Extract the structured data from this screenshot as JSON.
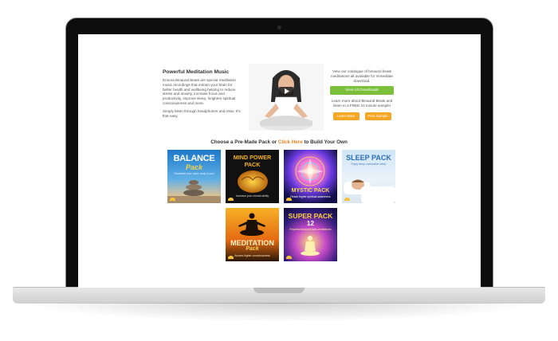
{
  "intro": {
    "title": "Powerful Meditation Music",
    "paragraph1": "Ennora Binaural Beats are special meditation music recordings that entrain your brain for better health and wellbeing helping to reduce stress and anxiety, increase focus and productivity, improve sleep, heighten spiritual consciousness and more.",
    "paragraph2": "Simply listen through headphones and relax. It's that easy.",
    "catalogue_text": "View our catalogue of binaural beats meditations all available for immediate download.",
    "view_downloads_label": "View All Downloads",
    "learn_more_text": "Learn more about Binaural Beats and listen to a FREE 10 minute sample!",
    "learn_more_label": "Learn More",
    "free_sample_label": "Free Sample"
  },
  "packs_heading": {
    "prefix": "Choose a Pre-Made Pack or",
    "link": "Click Here",
    "suffix": "to Build Your Own"
  },
  "packs": [
    {
      "name": "balance-pack",
      "title": "BALANCE",
      "title2": "Pack",
      "subtitle": "Revitalize your mind, body & soul"
    },
    {
      "name": "mind-power-pack",
      "title": "MIND POWER",
      "title2": "PACK",
      "subtitle": "Increase your mental ability"
    },
    {
      "name": "mystic-pack",
      "title": "MYSTIC PACK",
      "subtitle": "Reach higher spiritual awareness"
    },
    {
      "name": "sleep-pack",
      "title": "SLEEP PACK",
      "subtitle": "Enjoy deep, restorative sleep"
    },
    {
      "name": "meditation-pack",
      "title": "MEDITATION",
      "title2": "Pack",
      "subtitle": "Access higher consciousness"
    },
    {
      "name": "super-pack",
      "title": "SUPER PACK",
      "title2": "12",
      "subtitle": "Powerful binaural beat meditations"
    }
  ],
  "colors": {
    "green_button": "#7bbf3a",
    "orange_button": "#f5a623",
    "link_orange": "#f58220"
  },
  "icons": {
    "play": "play-icon"
  }
}
